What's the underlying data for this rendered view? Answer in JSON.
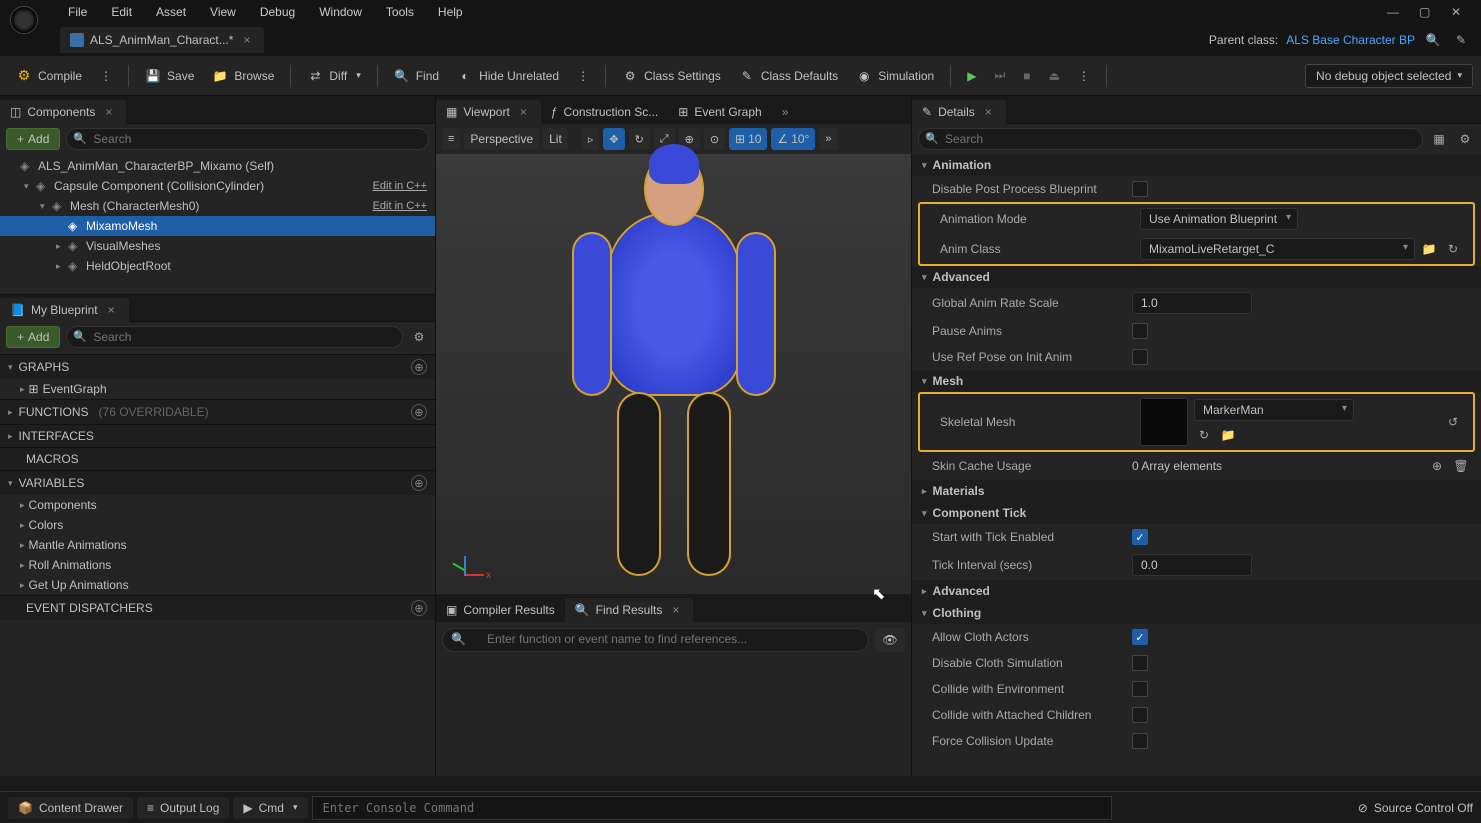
{
  "menus": [
    "File",
    "Edit",
    "Asset",
    "View",
    "Debug",
    "Window",
    "Tools",
    "Help"
  ],
  "fileTab": {
    "name": "ALS_AnimMan_Charact...*"
  },
  "parentClass": {
    "label": "Parent class:",
    "value": "ALS Base Character BP"
  },
  "toolbar": {
    "compile": "Compile",
    "save": "Save",
    "browse": "Browse",
    "diff": "Diff",
    "find": "Find",
    "hideUnrelated": "Hide Unrelated",
    "classSettings": "Class Settings",
    "classDefaults": "Class Defaults",
    "simulation": "Simulation"
  },
  "debugSelect": "No debug object selected",
  "panels": {
    "components": "Components",
    "myBlueprint": "My Blueprint",
    "viewport": "Viewport",
    "constructionScript": "Construction Sc...",
    "eventGraph": "Event Graph",
    "details": "Details",
    "compilerResults": "Compiler Results",
    "findResults": "Find Results"
  },
  "add": "Add",
  "searchPlaceholder": "Search",
  "componentsTree": [
    {
      "label": "ALS_AnimMan_CharacterBP_Mixamo (Self)",
      "indent": 0,
      "icon": "pawn"
    },
    {
      "label": "Capsule Component (CollisionCylinder)",
      "indent": 1,
      "icon": "capsule",
      "edit": "Edit in C++",
      "arrow": "▾"
    },
    {
      "label": "Mesh (CharacterMesh0)",
      "indent": 2,
      "icon": "mesh",
      "edit": "Edit in C++",
      "arrow": "▾"
    },
    {
      "label": "MixamoMesh",
      "indent": 3,
      "icon": "mesh",
      "selected": true
    },
    {
      "label": "VisualMeshes",
      "indent": 3,
      "icon": "folder",
      "arrow": "▸"
    },
    {
      "label": "HeldObjectRoot",
      "indent": 3,
      "icon": "folder",
      "arrow": "▸"
    }
  ],
  "bpSections": {
    "graphs": "GRAPHS",
    "eventGraph": "EventGraph",
    "functions": "FUNCTIONS",
    "functionsNote": "(76 OVERRIDABLE)",
    "interfaces": "INTERFACES",
    "macros": "MACROS",
    "variables": "VARIABLES",
    "varItems": [
      "Components",
      "Colors",
      "Mantle Animations",
      "Roll Animations",
      "Get Up Animations"
    ],
    "eventDispatchers": "EVENT DISPATCHERS"
  },
  "viewportToolbar": {
    "perspective": "Perspective",
    "lit": "Lit",
    "grid": "10",
    "angle": "10°"
  },
  "findPlaceholder": "Enter function or event name to find references...",
  "details": {
    "catAnimation": "Animation",
    "disablePostProcess": "Disable Post Process Blueprint",
    "animationMode": {
      "label": "Animation Mode",
      "value": "Use Animation Blueprint"
    },
    "animClass": {
      "label": "Anim Class",
      "value": "MixamoLiveRetarget_C"
    },
    "catAdvanced": "Advanced",
    "globalRate": {
      "label": "Global Anim Rate Scale",
      "value": "1.0"
    },
    "pauseAnims": "Pause Anims",
    "useRefPose": "Use Ref Pose on Init Anim",
    "catMesh": "Mesh",
    "skeletalMesh": {
      "label": "Skeletal Mesh",
      "value": "MarkerMan"
    },
    "skinCache": {
      "label": "Skin Cache Usage",
      "value": "0 Array elements"
    },
    "catMaterials": "Materials",
    "catComponentTick": "Component Tick",
    "startTick": "Start with Tick Enabled",
    "tickInterval": {
      "label": "Tick Interval (secs)",
      "value": "0.0"
    },
    "catClothing": "Clothing",
    "allowCloth": "Allow Cloth Actors",
    "disableCloth": "Disable Cloth Simulation",
    "collideEnv": "Collide with Environment",
    "collideChildren": "Collide with Attached Children",
    "forceCollision": "Force Collision Update"
  },
  "statusbar": {
    "contentDrawer": "Content Drawer",
    "outputLog": "Output Log",
    "cmd": "Cmd",
    "cmdPlaceholder": "Enter Console Command",
    "sourceControl": "Source Control Off"
  }
}
